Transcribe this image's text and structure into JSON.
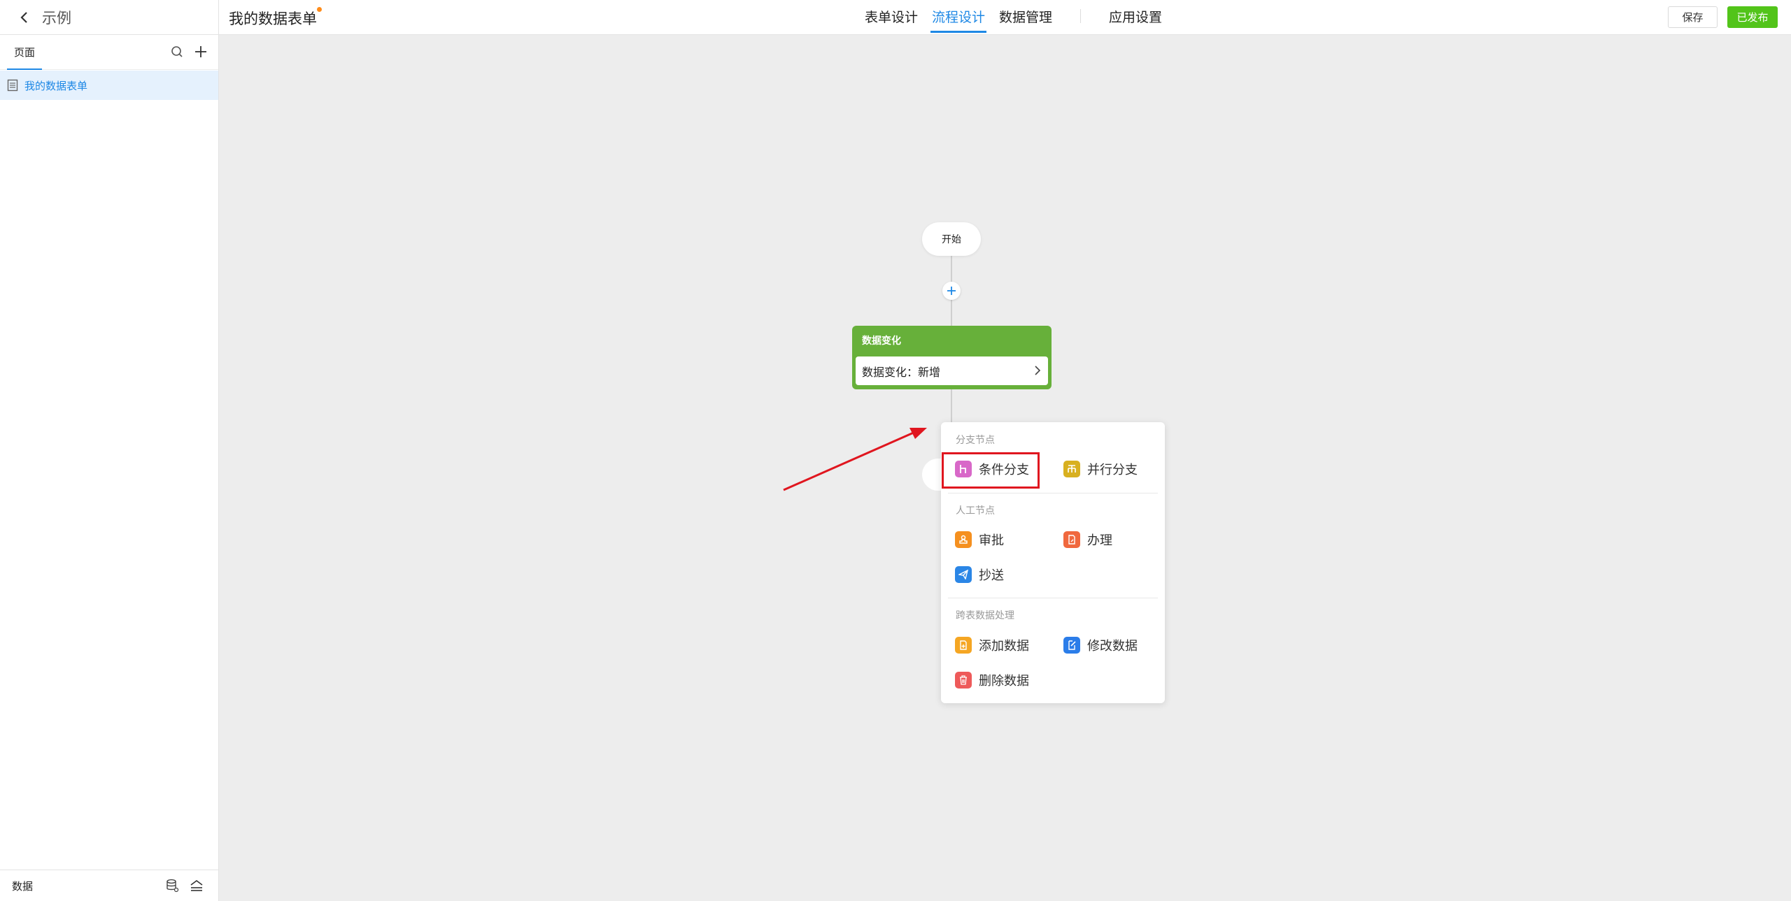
{
  "header": {
    "app_name": "示例",
    "form_title": "我的数据表单",
    "tabs": [
      {
        "label": "表单设计",
        "active": false
      },
      {
        "label": "流程设计",
        "active": true
      },
      {
        "label": "数据管理",
        "active": false
      },
      {
        "label": "应用设置",
        "active": false
      }
    ],
    "save_label": "保存",
    "publish_label": "已发布"
  },
  "sidebar": {
    "tab_label": "页面",
    "pages": [
      {
        "label": "我的数据表单",
        "selected": true
      }
    ],
    "footer_label": "数据"
  },
  "flow": {
    "start_label": "开始",
    "trigger_title": "数据变化",
    "trigger_text": "数据变化：新增"
  },
  "node_menu": {
    "sections": [
      {
        "title": "分支节点",
        "items": [
          {
            "label": "条件分支",
            "icon": "condition-branch-icon",
            "color": "#d868c8"
          },
          {
            "label": "并行分支",
            "icon": "parallel-branch-icon",
            "color": "#d8b020"
          }
        ]
      },
      {
        "title": "人工节点",
        "items": [
          {
            "label": "审批",
            "icon": "approve-icon",
            "color": "#f5901f"
          },
          {
            "label": "办理",
            "icon": "handle-icon",
            "color": "#f0683e"
          },
          {
            "label": "抄送",
            "icon": "cc-send-icon",
            "color": "#2b86e6"
          }
        ]
      },
      {
        "title": "跨表数据处理",
        "items": [
          {
            "label": "添加数据",
            "icon": "add-data-icon",
            "color": "#f5a623"
          },
          {
            "label": "修改数据",
            "icon": "edit-data-icon",
            "color": "#2b7de9"
          },
          {
            "label": "删除数据",
            "icon": "delete-data-icon",
            "color": "#ee5a5a"
          }
        ]
      }
    ]
  },
  "colors": {
    "accent": "#1e88e5",
    "publish": "#52c41a",
    "trigger": "#67b03a",
    "annotation": "#e0161f"
  }
}
